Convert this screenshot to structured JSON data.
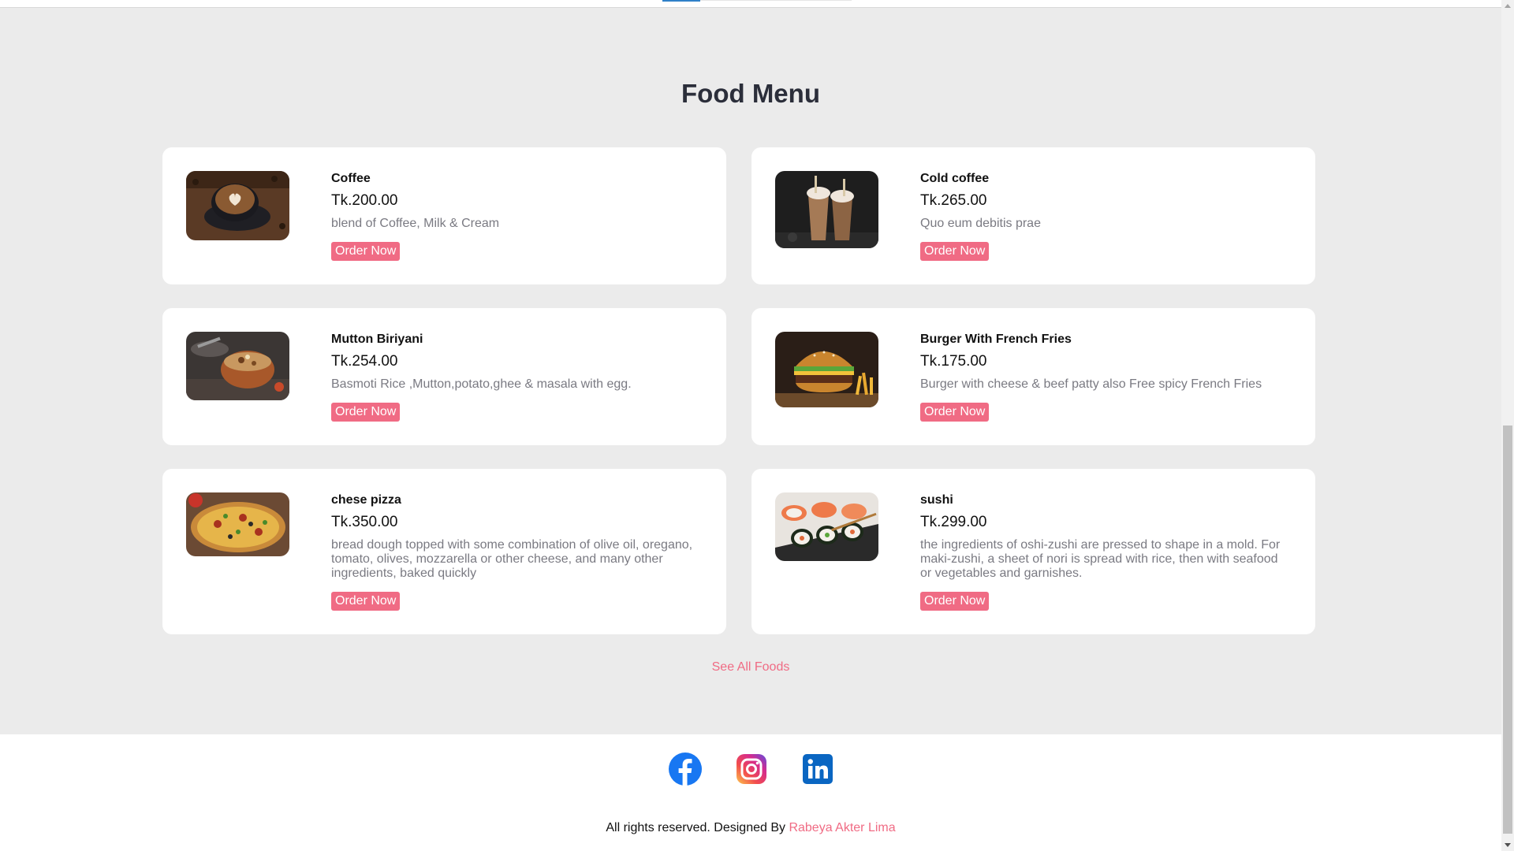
{
  "section": {
    "title": "Food Menu"
  },
  "menu": {
    "order_label": "Order Now",
    "items": [
      {
        "name": "Coffee",
        "price": "Tk.200.00",
        "description": "blend of Coffee, Milk & Cream",
        "image": "coffee-cup-photo"
      },
      {
        "name": "Cold coffee",
        "price": "Tk.265.00",
        "description": "Quo eum debitis prae",
        "image": "cold-coffee-photo"
      },
      {
        "name": "Mutton Biriyani",
        "price": "Tk.254.00",
        "description": "Basmoti Rice ,Mutton,potato,ghee & masala with egg.",
        "image": "biriyani-photo"
      },
      {
        "name": "Burger With French Fries",
        "price": "Tk.175.00",
        "description": "Burger with cheese & beef patty also Free spicy French Fries",
        "image": "burger-photo"
      },
      {
        "name": "chese pizza",
        "price": "Tk.350.00",
        "description": "bread dough topped with some combination of olive oil, oregano, tomato, olives, mozzarella or other cheese, and many other ingredients, baked quickly",
        "image": "pizza-photo"
      },
      {
        "name": "sushi",
        "price": "Tk.299.00",
        "description": "the ingredients of oshi-zushi are pressed to shape in a mold. For maki-zushi, a sheet of nori is spread with rice, then with seafood or vegetables and garnishes.",
        "image": "sushi-photo"
      }
    ],
    "see_all_label": "See All Foods"
  },
  "footer": {
    "socials": [
      "facebook-icon",
      "instagram-icon",
      "linkedin-icon"
    ],
    "copyright_prefix": "All rights reserved. Designed By",
    "designer": "Rabeya Akter Lima"
  },
  "colors": {
    "accent": "#f06b84",
    "page_background": "#ebebeb",
    "card_background": "#ffffff",
    "title": "#2b2e3a",
    "description": "#7a7a82"
  }
}
